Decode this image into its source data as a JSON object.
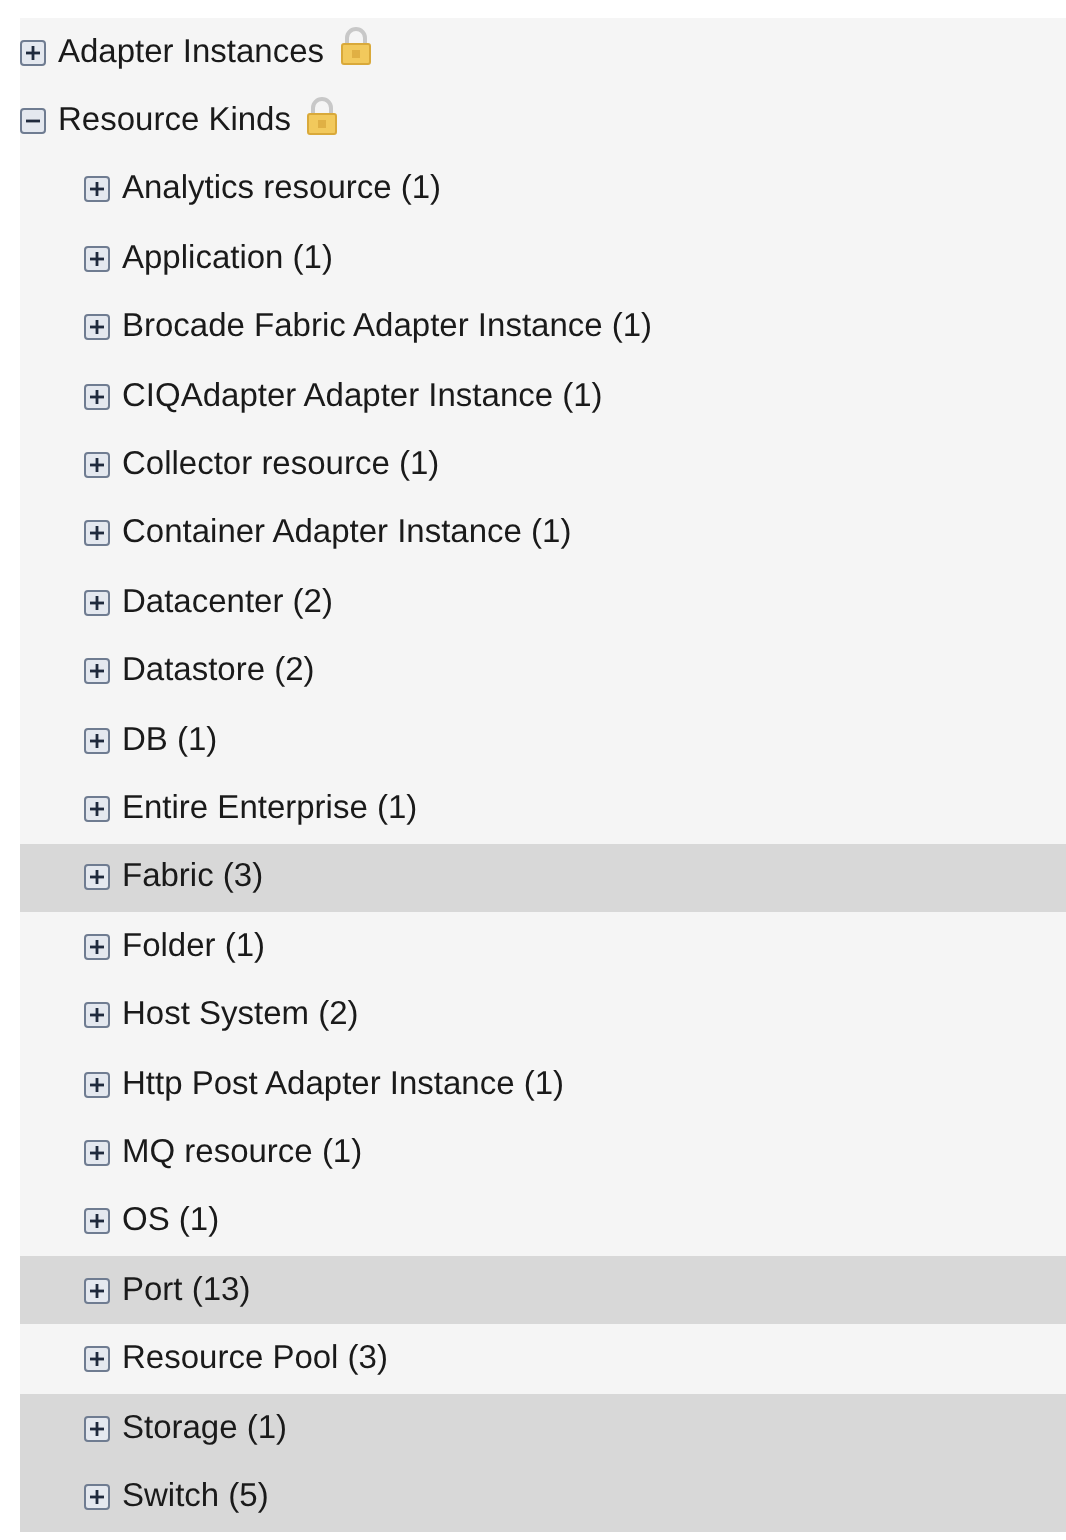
{
  "tree": [
    {
      "label": "Adapter Instances",
      "locked": true,
      "expanded": false,
      "selected": false
    },
    {
      "label": "Resource Kinds",
      "locked": true,
      "expanded": true,
      "selected": false,
      "children": [
        {
          "label": "Analytics resource (1)",
          "expanded": false,
          "selected": false
        },
        {
          "label": "Application (1)",
          "expanded": false,
          "selected": false
        },
        {
          "label": "Brocade Fabric Adapter Instance (1)",
          "expanded": false,
          "selected": false
        },
        {
          "label": "CIQAdapter Adapter Instance (1)",
          "expanded": false,
          "selected": false
        },
        {
          "label": "Collector resource (1)",
          "expanded": false,
          "selected": false
        },
        {
          "label": "Container Adapter Instance (1)",
          "expanded": false,
          "selected": false
        },
        {
          "label": "Datacenter (2)",
          "expanded": false,
          "selected": false
        },
        {
          "label": "Datastore (2)",
          "expanded": false,
          "selected": false
        },
        {
          "label": "DB (1)",
          "expanded": false,
          "selected": false
        },
        {
          "label": "Entire Enterprise (1)",
          "expanded": false,
          "selected": false
        },
        {
          "label": "Fabric (3)",
          "expanded": false,
          "selected": true
        },
        {
          "label": "Folder (1)",
          "expanded": false,
          "selected": false
        },
        {
          "label": "Host System (2)",
          "expanded": false,
          "selected": false
        },
        {
          "label": "Http Post Adapter Instance (1)",
          "expanded": false,
          "selected": false
        },
        {
          "label": "MQ resource (1)",
          "expanded": false,
          "selected": false
        },
        {
          "label": "OS (1)",
          "expanded": false,
          "selected": false
        },
        {
          "label": "Port (13)",
          "expanded": false,
          "selected": true
        },
        {
          "label": "Resource Pool (3)",
          "expanded": false,
          "selected": false
        },
        {
          "label": "Storage (1)",
          "expanded": false,
          "selected": true
        },
        {
          "label": "Switch (5)",
          "expanded": false,
          "selected": true
        }
      ]
    }
  ]
}
